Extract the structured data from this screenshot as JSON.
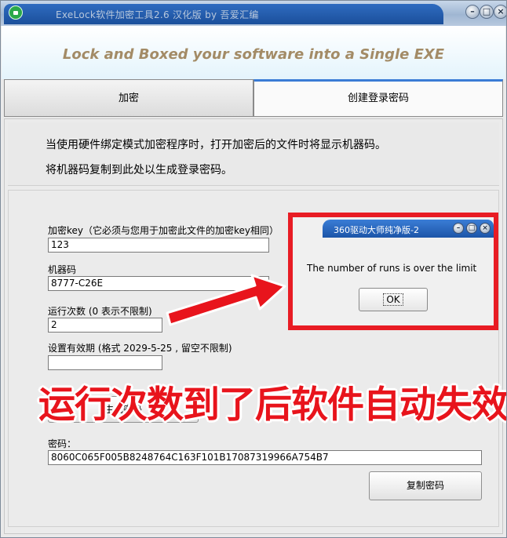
{
  "window": {
    "title": "ExeLock软件加密工具2.6 汉化版 by 吾爱汇编",
    "controls": {
      "minimize": "–",
      "maximize": "□",
      "close": "×"
    }
  },
  "header": {
    "slogan": "Lock and Boxed your software into a Single EXE"
  },
  "tabs": [
    {
      "label": "加密",
      "active": false
    },
    {
      "label": "创建登录密码",
      "active": true
    }
  ],
  "info": {
    "line1": "当使用硬件绑定模式加密程序时，打开加密后的文件时将显示机器码。",
    "line2": "将机器码复制到此处以生成登录密码。"
  },
  "form": {
    "key_label": "加密key（它必须与您用于加密此文件的加密key相同）",
    "key_value": "123",
    "machine_label": "机器码",
    "machine_value": "8777-C26E",
    "runs_label": "运行次数 (0 表示不限制)",
    "runs_value": "2",
    "expiry_label": "设置有效期 (格式 2029-5-25 , 留空不限制)",
    "expiry_value": "",
    "generate_button": "生成密码",
    "password_label": "密码：",
    "password_value": "8060C065F005B8248764C163F101B17087319966A754B7",
    "copy_button": "复制密码"
  },
  "dialog": {
    "title": "360驱动大师纯净版-2",
    "message": "The number of runs is over the limit",
    "ok_label": "OK"
  },
  "annotation": {
    "text": "运行次数到了后软件自动失效",
    "color": "#e8141c"
  }
}
